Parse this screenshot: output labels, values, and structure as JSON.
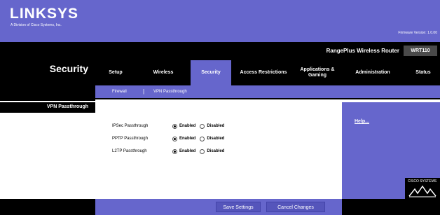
{
  "brand": {
    "logo_text": "LINKSYS",
    "logo_sub": "A Division of Cisco Systems, Inc.",
    "firmware": "Firmware Version: 1.0.00"
  },
  "page": {
    "title": "Security",
    "product_name": "RangePlus Wireless Router",
    "model": "WRT110"
  },
  "tabs": [
    {
      "label": "Setup"
    },
    {
      "label": "Wireless"
    },
    {
      "label": "Security"
    },
    {
      "label": "Access Restrictions"
    },
    {
      "label": "Applications & Gaming"
    },
    {
      "label": "Administration"
    },
    {
      "label": "Status"
    }
  ],
  "subnav": {
    "firewall": "Firewall",
    "separator": "|",
    "vpn": "VPN Passthrough"
  },
  "section_label": "VPN Passthrough",
  "rows": [
    {
      "label": "IPSec Passthrough",
      "enabled": "Enabled",
      "disabled": "Disabled",
      "selected": "Enabled"
    },
    {
      "label": "PPTP Passthrough",
      "enabled": "Enabled",
      "disabled": "Disabled",
      "selected": "Enabled"
    },
    {
      "label": "L2TP Passthrough",
      "enabled": "Enabled",
      "disabled": "Disabled",
      "selected": "Enabled"
    }
  ],
  "help": {
    "link": "Help..."
  },
  "footer": {
    "save": "Save Settings",
    "cancel": "Cancel Changes",
    "cisco": "CISCO SYSTEMS"
  },
  "colors": {
    "accent": "#6666cc",
    "dark": "#000000"
  }
}
